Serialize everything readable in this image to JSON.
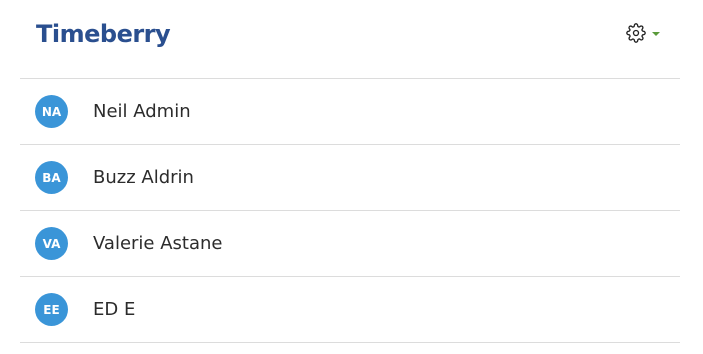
{
  "header": {
    "logo_text": "Timeberry",
    "settings_icon": "gear-icon",
    "dropdown_icon": "caret-down-icon"
  },
  "colors": {
    "brand": "#2a4f8f",
    "avatar_bg": "#3a95d8",
    "caret": "#5a9a3a"
  },
  "users": [
    {
      "initials": "NA",
      "name": "Neil Admin"
    },
    {
      "initials": "BA",
      "name": "Buzz Aldrin"
    },
    {
      "initials": "VA",
      "name": "Valerie Astane"
    },
    {
      "initials": "EE",
      "name": "ED E"
    }
  ]
}
